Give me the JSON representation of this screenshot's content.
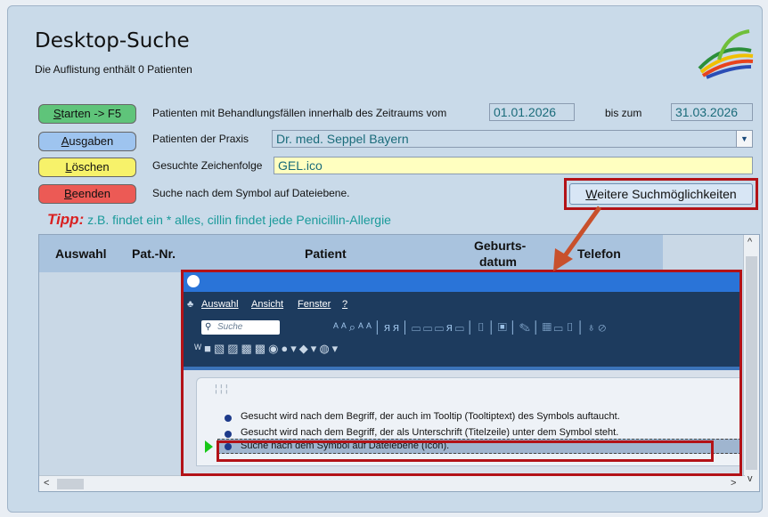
{
  "window": {
    "title": "Desktop-Suche",
    "subtitle": "Die Auflistung enthält 0 Patienten"
  },
  "buttons": {
    "start": "Starten -> F5",
    "start_hotkey": "S",
    "output": "Ausgaben",
    "output_hotkey": "A",
    "delete": "Löschen",
    "delete_hotkey": "L",
    "end": "Beenden",
    "end_hotkey": "B",
    "more": "Weitere Suchmöglichkeiten",
    "more_hotkey": "W"
  },
  "form": {
    "period_label": "Patienten mit Behandlungsfällen innerhalb des Zeitraums vom",
    "date_from": "01.01.2026",
    "date_to_label": "bis zum",
    "date_to": "31.03.2026",
    "practice_label": "Patienten der Praxis",
    "practice_value": "Dr. med. Seppel Bayern",
    "search_label": "Gesuchte Zeichenfolge",
    "search_value": "GEL.ico",
    "search_hint": "Suche nach dem Symbol auf Dateiebene."
  },
  "tip": {
    "label": "Tipp:",
    "text": "z.B. findet ein * alles, cillin findet jede Penicillin-Allergie"
  },
  "table": {
    "columns": [
      "Auswahl",
      "Pat.-Nr.",
      "Patient",
      "Geburts-",
      "datum",
      "Telefon"
    ]
  },
  "inset": {
    "menu": [
      "Auswahl",
      "Ansicht",
      "Fenster",
      "?"
    ],
    "search_placeholder": "Suche",
    "items": [
      "Gesucht wird nach dem Begriff, der auch im Tooltip (Tooltiptext) des Symbols auftaucht.",
      "Gesucht wird nach dem Begriff, der als Unterschrift (Titelzeile) unter dem Symbol steht.",
      "Suche nach dem Symbol auf Dateiebene (Icon)."
    ]
  },
  "colors": {
    "highlight": "#b31217",
    "accent_text": "#1a6b7a",
    "tip_label": "#d92020"
  }
}
